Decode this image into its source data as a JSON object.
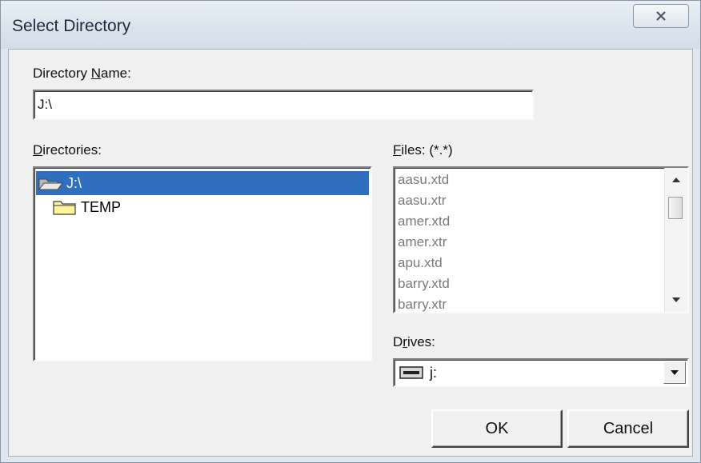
{
  "window": {
    "title": "Select Directory"
  },
  "directory_name": {
    "label_prefix": "Directory ",
    "label_accel": "N",
    "label_suffix": "ame:",
    "value": "J:\\"
  },
  "directories": {
    "label_accel": "D",
    "label_rest": "irectories:",
    "items": [
      {
        "label": "J:\\",
        "icon": "open-folder-icon",
        "selected": true
      },
      {
        "label": "TEMP",
        "icon": "folder-icon",
        "selected": false
      }
    ]
  },
  "files": {
    "label_accel": "F",
    "label_rest": "iles: (*.*)",
    "items": [
      "aasu.xtd",
      "aasu.xtr",
      "amer.xtd",
      "amer.xtr",
      "apu.xtd",
      "barry.xtd",
      "barry.xtr"
    ]
  },
  "drives": {
    "label_prefix": "D",
    "label_accel": "r",
    "label_rest": "ives:",
    "selected": "j:"
  },
  "buttons": {
    "ok": "OK",
    "cancel": "Cancel"
  }
}
